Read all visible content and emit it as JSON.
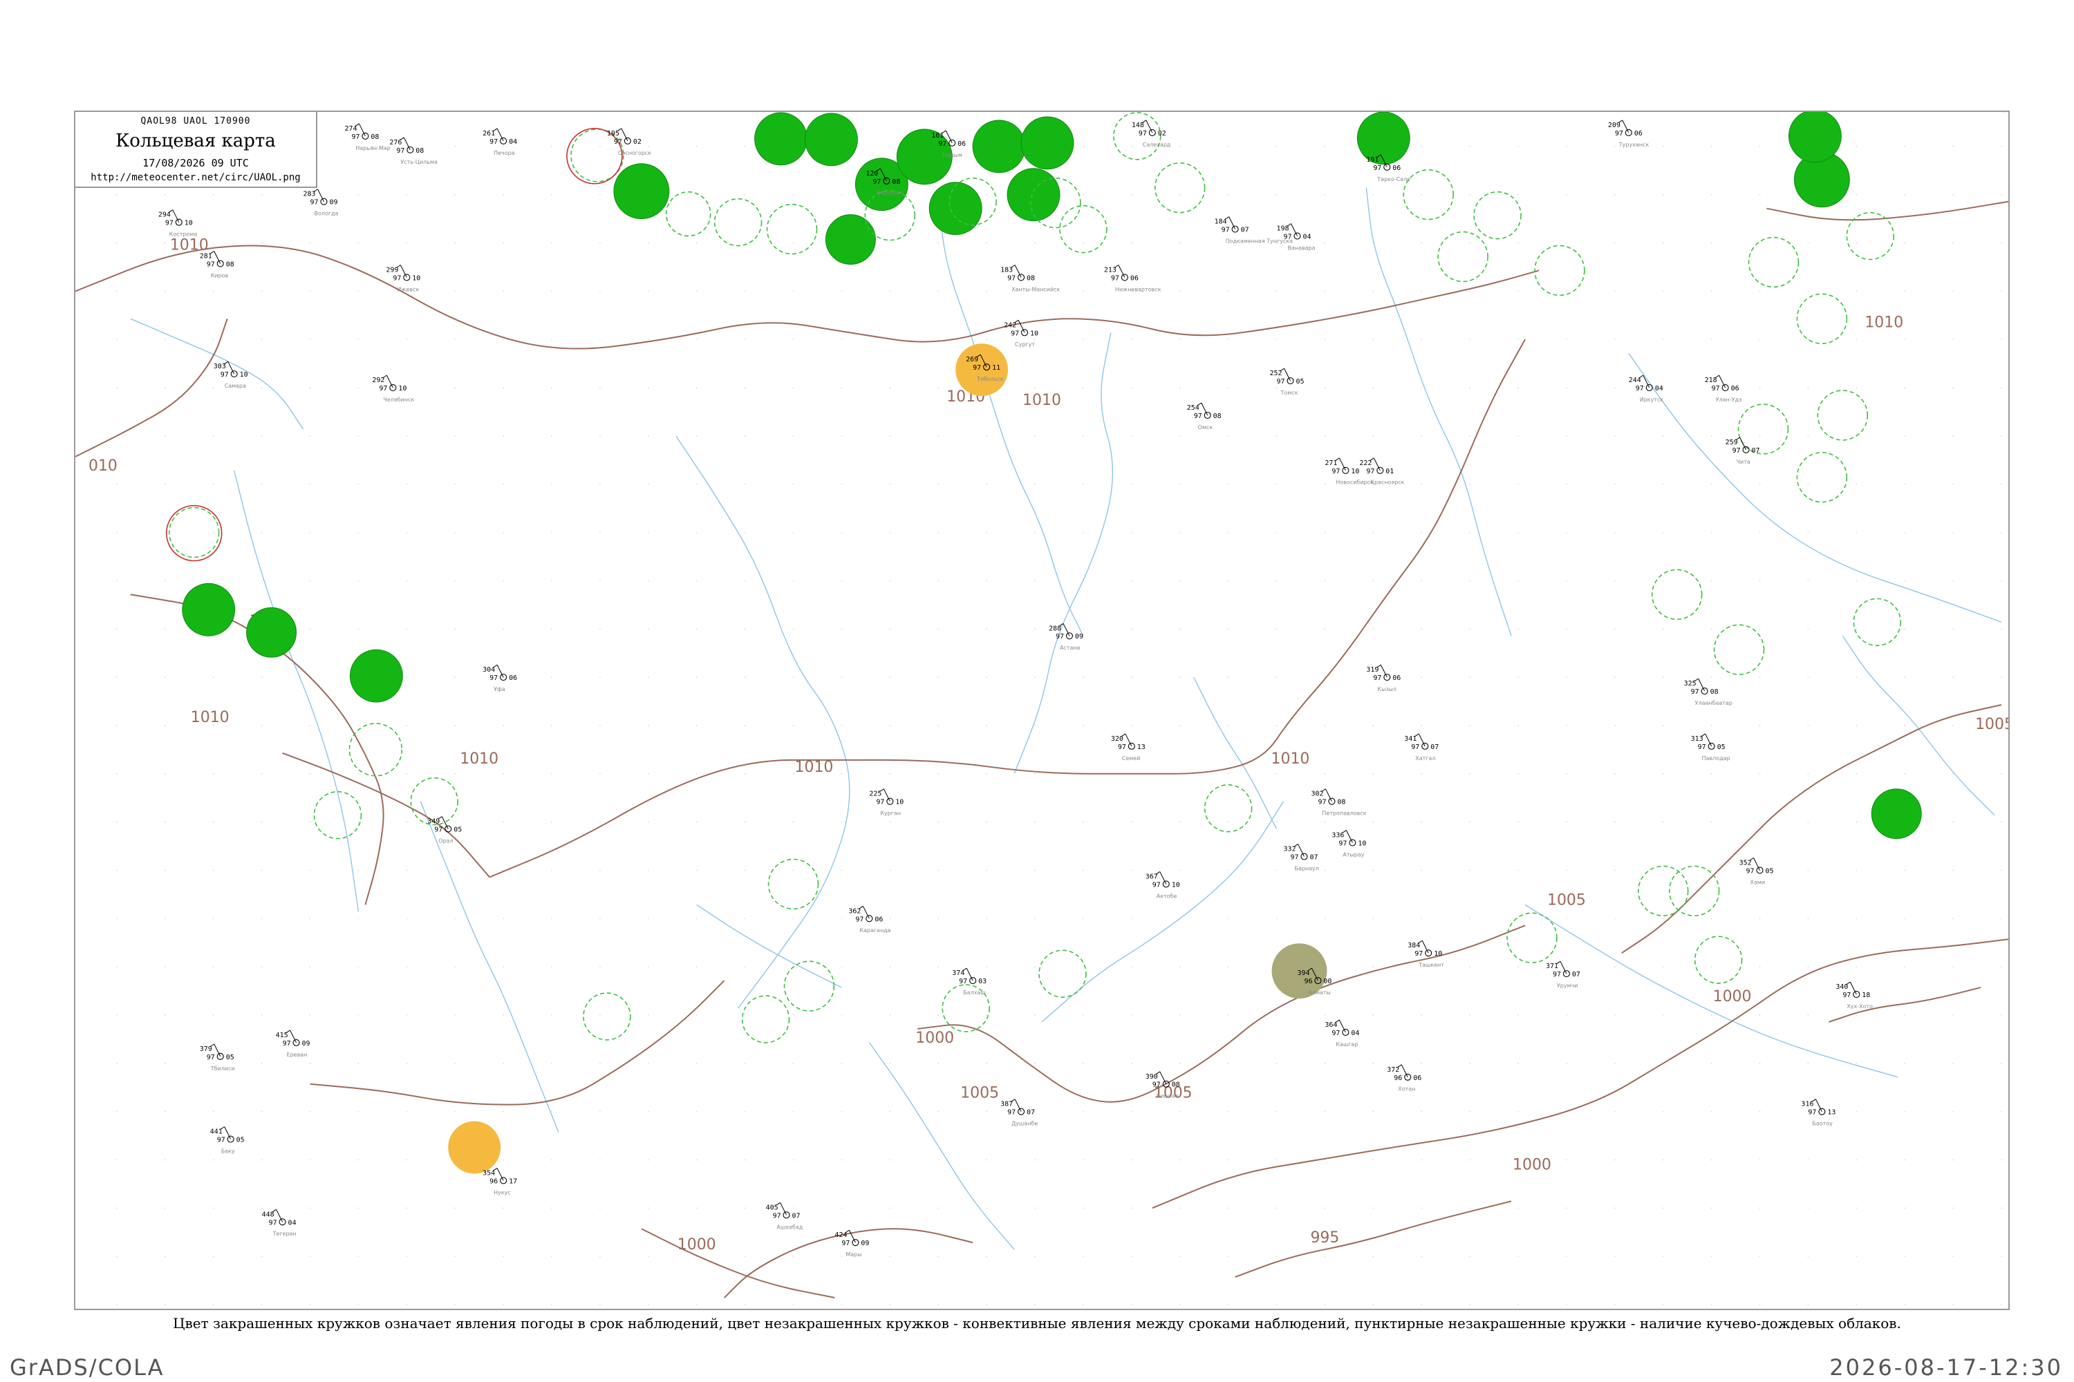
{
  "map": {
    "code": "QAOL98  UAOL  170900",
    "title": "Кольцевая карта",
    "datetime": "17/08/2026 09 UTC",
    "url": "http://meteocenter.net/circ/UAOL.png"
  },
  "caption": "Цвет закрашенных кружков означает явления погоды в срок наблюдений, цвет незакрашенных кружков - конвективные явления между сроками наблюдений, пунктирные незакрашенные кружки - наличие кучево-дождевых облаков.",
  "footer": {
    "left": "GrADS/COLA",
    "right": "2026-08-17-12:30"
  },
  "colors": {
    "isobar": "#9b6a5a",
    "river": "#8ec5e8",
    "precip_fill": "#14b614",
    "dust_fill": "#f5b940",
    "haze_fill": "#a8a878",
    "cb_dash": "#3fbf3f",
    "thunder_ring": "#c83030",
    "frame": "#999999"
  },
  "isobars": [
    {
      "label": "1010"
    },
    {
      "label": "1010"
    },
    {
      "label": "1010"
    },
    {
      "label": "1010"
    },
    {
      "label": "1010"
    },
    {
      "label": "1010"
    },
    {
      "label": "1010"
    },
    {
      "label": "1010"
    },
    {
      "label": "1010"
    },
    {
      "label": "1005"
    },
    {
      "label": "1005"
    },
    {
      "label": "1005"
    },
    {
      "label": "1005"
    },
    {
      "label": "1005"
    },
    {
      "label": "1000"
    },
    {
      "label": "1000"
    },
    {
      "label": "1000"
    },
    {
      "label": "1000"
    },
    {
      "label": "995"
    },
    {
      "label": "010"
    }
  ],
  "stations": [
    {
      "p": "274",
      "t": "97",
      "dp": "08",
      "name": "Нарьян-Мар"
    },
    {
      "p": "276",
      "t": "97",
      "dp": "08",
      "name": "Усть-Цильма"
    },
    {
      "p": "261",
      "t": "97",
      "dp": "04",
      "name": "Печора"
    },
    {
      "p": "195",
      "t": "97",
      "dp": "02",
      "name": "Сосногорск"
    },
    {
      "p": "148",
      "t": "97",
      "dp": "02",
      "name": "Салехард"
    },
    {
      "p": "191",
      "t": "97",
      "dp": "06",
      "name": "Тарко-Сале"
    },
    {
      "p": "209",
      "t": "97",
      "dp": "06",
      "name": "Туруханск"
    },
    {
      "p": "161",
      "t": "97",
      "dp": "06",
      "name": "Надым"
    },
    {
      "p": "120",
      "t": "97",
      "dp": "08",
      "name": "Березово"
    },
    {
      "p": "283",
      "t": "97",
      "dp": "09",
      "name": "Вологда"
    },
    {
      "p": "294",
      "t": "97",
      "dp": "10",
      "name": "Кострома"
    },
    {
      "p": "281",
      "t": "97",
      "dp": "08",
      "name": "Киров"
    },
    {
      "p": "299",
      "t": "97",
      "dp": "10",
      "name": "Ижевск"
    },
    {
      "p": "269",
      "t": "97",
      "dp": "11",
      "name": "Тобольск"
    },
    {
      "p": "183",
      "t": "97",
      "dp": "08",
      "name": "Ханты-Мансийск"
    },
    {
      "p": "242",
      "t": "97",
      "dp": "10",
      "name": "Сургут"
    },
    {
      "p": "213",
      "t": "97",
      "dp": "06",
      "name": "Нижневартовск"
    },
    {
      "p": "184",
      "t": "97",
      "dp": "07",
      "name": "Подкаменная Тунгуска"
    },
    {
      "p": "198",
      "t": "97",
      "dp": "04",
      "name": "Ванавара"
    },
    {
      "p": "254",
      "t": "97",
      "dp": "08",
      "name": "Омск"
    },
    {
      "p": "271",
      "t": "97",
      "dp": "10",
      "name": "Новосибирск"
    },
    {
      "p": "252",
      "t": "97",
      "dp": "05",
      "name": "Томск"
    },
    {
      "p": "222",
      "t": "97",
      "dp": "01",
      "name": "Красноярск"
    },
    {
      "p": "244",
      "t": "97",
      "dp": "04",
      "name": "Иркутск"
    },
    {
      "p": "218",
      "t": "97",
      "dp": "06",
      "name": "Улан-Удэ"
    },
    {
      "p": "259",
      "t": "97",
      "dp": "07",
      "name": "Чита"
    },
    {
      "p": "303",
      "t": "97",
      "dp": "10",
      "name": "Самара"
    },
    {
      "p": "304",
      "t": "97",
      "dp": "06",
      "name": "Уфа"
    },
    {
      "p": "292",
      "t": "97",
      "dp": "10",
      "name": "Челябинск"
    },
    {
      "p": "225",
      "t": "97",
      "dp": "10",
      "name": "Курган"
    },
    {
      "p": "302",
      "t": "97",
      "dp": "08",
      "name": "Петропавловск"
    },
    {
      "p": "288",
      "t": "97",
      "dp": "09",
      "name": "Астана"
    },
    {
      "p": "313",
      "t": "97",
      "dp": "05",
      "name": "Павлодар"
    },
    {
      "p": "320",
      "t": "97",
      "dp": "13",
      "name": "Семей"
    },
    {
      "p": "332",
      "t": "97",
      "dp": "07",
      "name": "Барнаул"
    },
    {
      "p": "319",
      "t": "97",
      "dp": "06",
      "name": "Кызыл"
    },
    {
      "p": "325",
      "t": "97",
      "dp": "08",
      "name": "Улаанбаатар"
    },
    {
      "p": "341",
      "t": "97",
      "dp": "07",
      "name": "Хатгал"
    },
    {
      "p": "336",
      "t": "97",
      "dp": "10",
      "name": "Атырау"
    },
    {
      "p": "367",
      "t": "97",
      "dp": "10",
      "name": "Актобе"
    },
    {
      "p": "349",
      "t": "97",
      "dp": "05",
      "name": "Орал"
    },
    {
      "p": "362",
      "t": "97",
      "dp": "06",
      "name": "Караганда"
    },
    {
      "p": "374",
      "t": "97",
      "dp": "03",
      "name": "Балхаш"
    },
    {
      "p": "394",
      "t": "96",
      "dp": "00",
      "name": "Алматы"
    },
    {
      "p": "390",
      "t": "97",
      "dp": "08",
      "name": "Бишкек"
    },
    {
      "p": "371",
      "t": "97",
      "dp": "07",
      "name": "Урумчи"
    },
    {
      "p": "352",
      "t": "97",
      "dp": "05",
      "name": "Хами"
    },
    {
      "p": "316",
      "t": "97",
      "dp": "13",
      "name": "Баотоу"
    },
    {
      "p": "340",
      "t": "97",
      "dp": "18",
      "name": "Хух-Хото"
    },
    {
      "p": "354",
      "t": "96",
      "dp": "17",
      "name": "Нукус"
    },
    {
      "p": "384",
      "t": "97",
      "dp": "10",
      "name": "Ташкент"
    },
    {
      "p": "387",
      "t": "97",
      "dp": "07",
      "name": "Душанбе"
    },
    {
      "p": "364",
      "t": "97",
      "dp": "04",
      "name": "Кашгар"
    },
    {
      "p": "372",
      "t": "96",
      "dp": "06",
      "name": "Хотан"
    },
    {
      "p": "405",
      "t": "97",
      "dp": "07",
      "name": "Ашхабад"
    },
    {
      "p": "424",
      "t": "97",
      "dp": "09",
      "name": "Мары"
    },
    {
      "p": "441",
      "t": "97",
      "dp": "05",
      "name": "Баку"
    },
    {
      "p": "379",
      "t": "97",
      "dp": "05",
      "name": "Тбилиси"
    },
    {
      "p": "415",
      "t": "97",
      "dp": "09",
      "name": "Ереван"
    },
    {
      "p": "448",
      "t": "97",
      "dp": "04",
      "name": "Тегеран"
    }
  ]
}
